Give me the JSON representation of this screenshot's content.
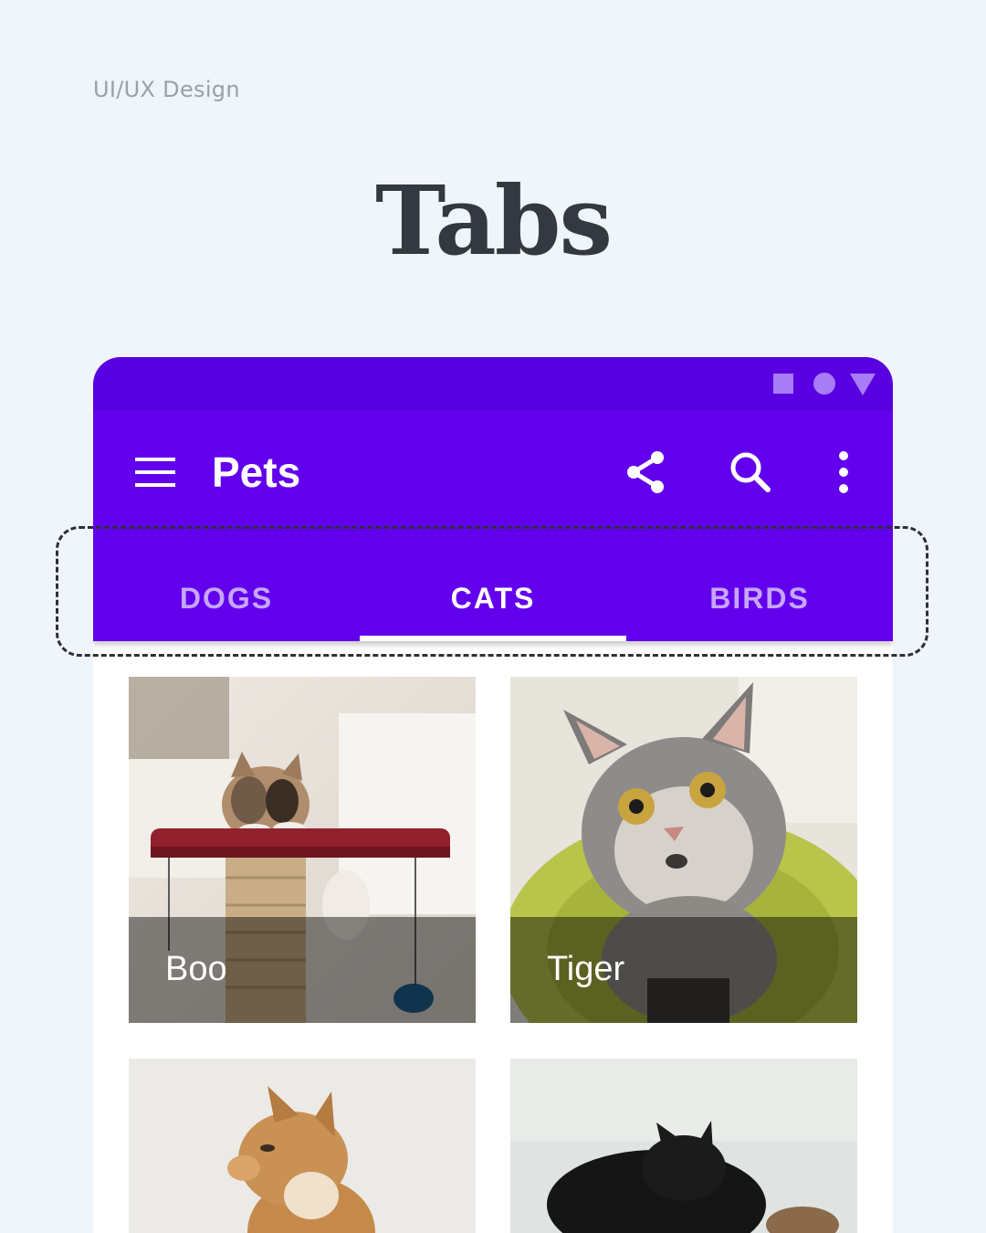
{
  "header": {
    "eyebrow": "UI/UX Design",
    "title": "Tabs"
  },
  "status_bar": {
    "icons": [
      "square-icon",
      "circle-icon",
      "triangle-icon"
    ]
  },
  "app_bar": {
    "title": "Pets",
    "actions": [
      "share-icon",
      "search-icon",
      "more-vert-icon"
    ],
    "color": "#6200ee",
    "status_color": "#5800e0"
  },
  "tabs": [
    {
      "label": "DOGS",
      "active": false
    },
    {
      "label": "CATS",
      "active": true
    },
    {
      "label": "BIRDS",
      "active": false
    }
  ],
  "grid": {
    "items": [
      {
        "name": "Boo"
      },
      {
        "name": "Tiger"
      },
      {
        "name": ""
      },
      {
        "name": ""
      }
    ]
  }
}
